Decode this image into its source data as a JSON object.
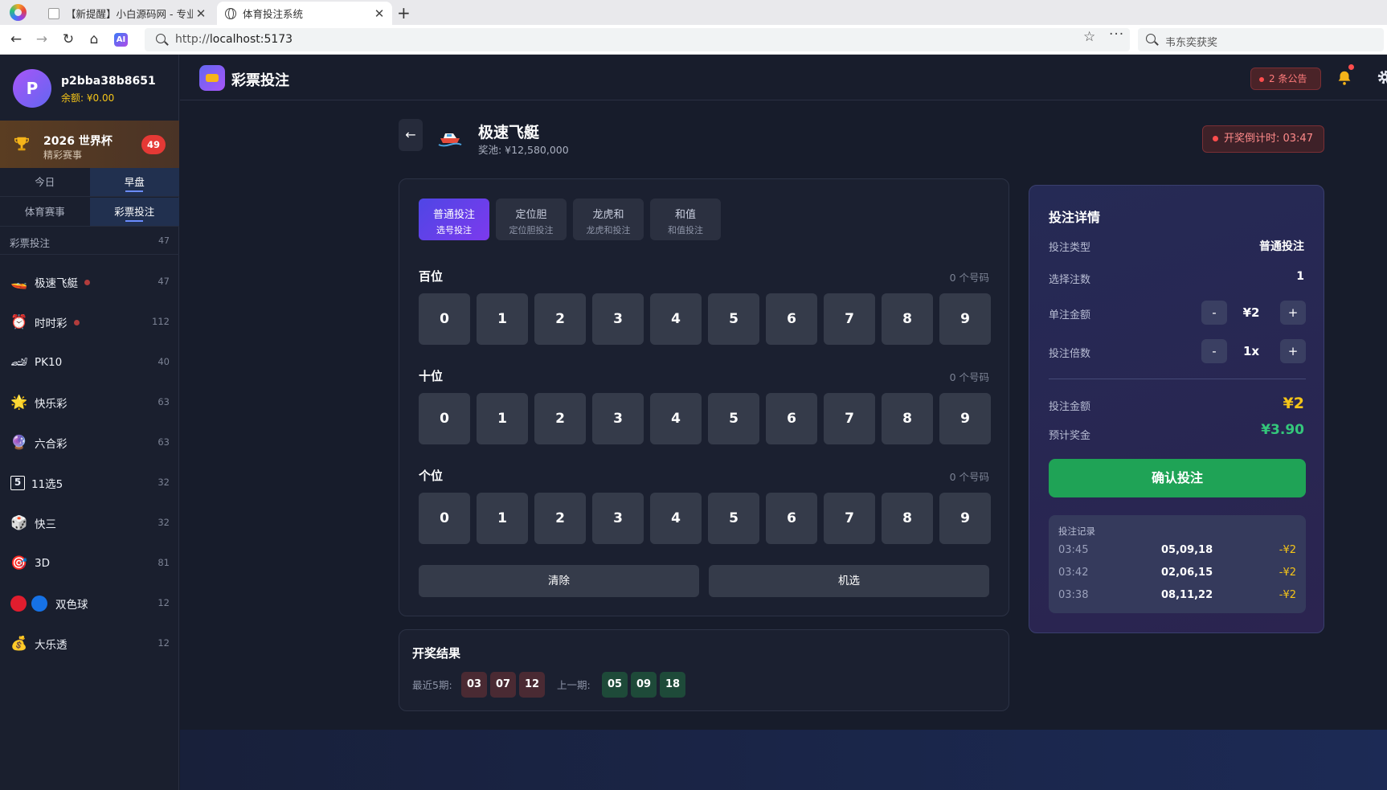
{
  "browser": {
    "tabs": [
      {
        "title": "【新提醒】小白源码网 - 专业"
      },
      {
        "title": "体育投注系统"
      }
    ],
    "url_scheme": "http://",
    "url_host": "localhost:5173",
    "side_search": "韦东奕获奖"
  },
  "user": {
    "avatar_letter": "P",
    "name": "p2bba38b8651",
    "balance": "余额: ¥0.00"
  },
  "promo": {
    "title": "2026 世界杯",
    "subtitle": "精彩赛事",
    "badge": "49"
  },
  "segments": {
    "row1": [
      "今日",
      "早盘"
    ],
    "row2": [
      "体育赛事",
      "彩票投注"
    ]
  },
  "category": {
    "label": "彩票投注",
    "count": "47"
  },
  "games": [
    {
      "name": "极速飞艇",
      "count": "47",
      "icon": "🚤",
      "live": true
    },
    {
      "name": "时时彩",
      "count": "112",
      "icon": "⏰",
      "live": true
    },
    {
      "name": "PK10",
      "count": "40",
      "icon": "🏎",
      "live": false
    },
    {
      "name": "快乐彩",
      "count": "63",
      "icon": "🌟",
      "live": false
    },
    {
      "name": "六合彩",
      "count": "63",
      "icon": "🔮",
      "live": false
    },
    {
      "name": "11选5",
      "count": "32",
      "icon": "5",
      "live": false
    },
    {
      "name": "快三",
      "count": "32",
      "icon": "🎲",
      "live": false
    },
    {
      "name": "3D",
      "count": "81",
      "icon": "🎯",
      "live": false
    },
    {
      "name": "双色球",
      "count": "12",
      "icon": "balls",
      "live": false
    },
    {
      "name": "大乐透",
      "count": "12",
      "icon": "💰",
      "live": false
    }
  ],
  "topbar": {
    "title": "彩票投注",
    "notice": "2 条公告"
  },
  "game": {
    "title": "极速飞艇",
    "prize_pool": "奖池: ¥12,580,000",
    "countdown": "开奖倒计时: 03:47",
    "back": "←"
  },
  "mode_tabs": [
    {
      "title": "普通投注",
      "sub": "选号投注"
    },
    {
      "title": "定位胆",
      "sub": "定位胆投注"
    },
    {
      "title": "龙虎和",
      "sub": "龙虎和投注"
    },
    {
      "title": "和值",
      "sub": "和值投注"
    }
  ],
  "positions": [
    {
      "label": "百位",
      "count": "0 个号码"
    },
    {
      "label": "十位",
      "count": "0 个号码"
    },
    {
      "label": "个位",
      "count": "0 个号码"
    }
  ],
  "digits": [
    "0",
    "1",
    "2",
    "3",
    "4",
    "5",
    "6",
    "7",
    "8",
    "9"
  ],
  "actions": {
    "clear": "清除",
    "random": "机选"
  },
  "results": {
    "title": "开奖结果",
    "recent_label": "最近5期:",
    "recent_balls": [
      "03",
      "07",
      "12"
    ],
    "prev_label": "上一期:",
    "prev_balls": [
      "05",
      "09",
      "18"
    ]
  },
  "detail": {
    "title": "投注详情",
    "bet_type_label": "投注类型",
    "bet_type": "普通投注",
    "count_label": "选择注数",
    "count": "1",
    "unit_label": "单注金额",
    "unit": "¥2",
    "multiplier_label": "投注倍数",
    "multiplier": "1x",
    "minus": "-",
    "plus": "+",
    "total_label": "投注金额",
    "total": "¥2",
    "estimate_label": "预计奖金",
    "estimate": "¥3.90",
    "confirm": "确认投注",
    "history_title": "投注记录",
    "history": [
      {
        "time": "03:45",
        "nums": "05,09,18",
        "amount": "-¥2"
      },
      {
        "time": "03:42",
        "nums": "02,06,15",
        "amount": "-¥2"
      },
      {
        "time": "03:38",
        "nums": "08,11,22",
        "amount": "-¥2"
      }
    ]
  }
}
